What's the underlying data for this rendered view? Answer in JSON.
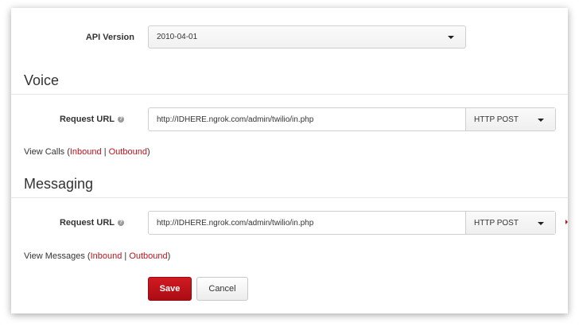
{
  "api_version": {
    "label": "API Version",
    "value": "2010-04-01"
  },
  "voice": {
    "title": "Voice",
    "request_url_label": "Request URL",
    "request_url_value": "http://IDHERE.ngrok.com/admin/twilio/in.php",
    "method": "HTTP POST",
    "links_prefix": "View Calls (",
    "inbound": "Inbound",
    "separator": " | ",
    "outbound": "Outbound",
    "links_suffix": ")"
  },
  "messaging": {
    "title": "Messaging",
    "request_url_label": "Request URL",
    "request_url_value": "http://IDHERE.ngrok.com/admin/twilio/in.php",
    "method": "HTTP POST",
    "links_prefix": "View Messages (",
    "inbound": "Inbound",
    "separator": " | ",
    "outbound": "Outbound",
    "links_suffix": ")"
  },
  "actions": {
    "save": "Save",
    "cancel": "Cancel"
  },
  "colors": {
    "accent": "#c1121b",
    "text": "#333333"
  }
}
